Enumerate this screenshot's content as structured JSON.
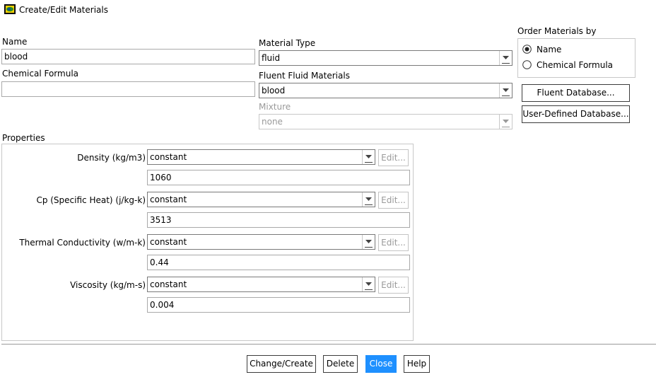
{
  "window": {
    "title": "Create/Edit Materials",
    "icon": "materials-app-icon"
  },
  "name_field": {
    "label": "Name",
    "value": "blood"
  },
  "formula_field": {
    "label": "Chemical Formula",
    "value": ""
  },
  "material_type": {
    "label": "Material Type",
    "value": "fluid"
  },
  "fluent_materials": {
    "label": "Fluent Fluid Materials",
    "value": "blood"
  },
  "mixture": {
    "label": "Mixture",
    "value": "none",
    "enabled": false
  },
  "order_by": {
    "label": "Order Materials by",
    "options": [
      {
        "label": "Name",
        "selected": true
      },
      {
        "label": "Chemical Formula",
        "selected": false
      }
    ]
  },
  "database_buttons": {
    "fluent": "Fluent Database...",
    "user": "User-Defined Database..."
  },
  "properties": {
    "label": "Properties",
    "edit_label": "Edit...",
    "items": [
      {
        "label": "Density (kg/m3)",
        "method": "constant",
        "value": "1060"
      },
      {
        "label": "Cp (Specific Heat) (j/kg-k)",
        "method": "constant",
        "value": "3513"
      },
      {
        "label": "Thermal Conductivity (w/m-k)",
        "method": "constant",
        "value": "0.44"
      },
      {
        "label": "Viscosity (kg/m-s)",
        "method": "constant",
        "value": "0.004"
      }
    ]
  },
  "footer_buttons": {
    "change_create": "Change/Create",
    "delete": "Delete",
    "close": "Close",
    "help": "Help"
  },
  "colors": {
    "primary_button": "#1e90ff",
    "disabled_text": "#9a9a9a"
  }
}
